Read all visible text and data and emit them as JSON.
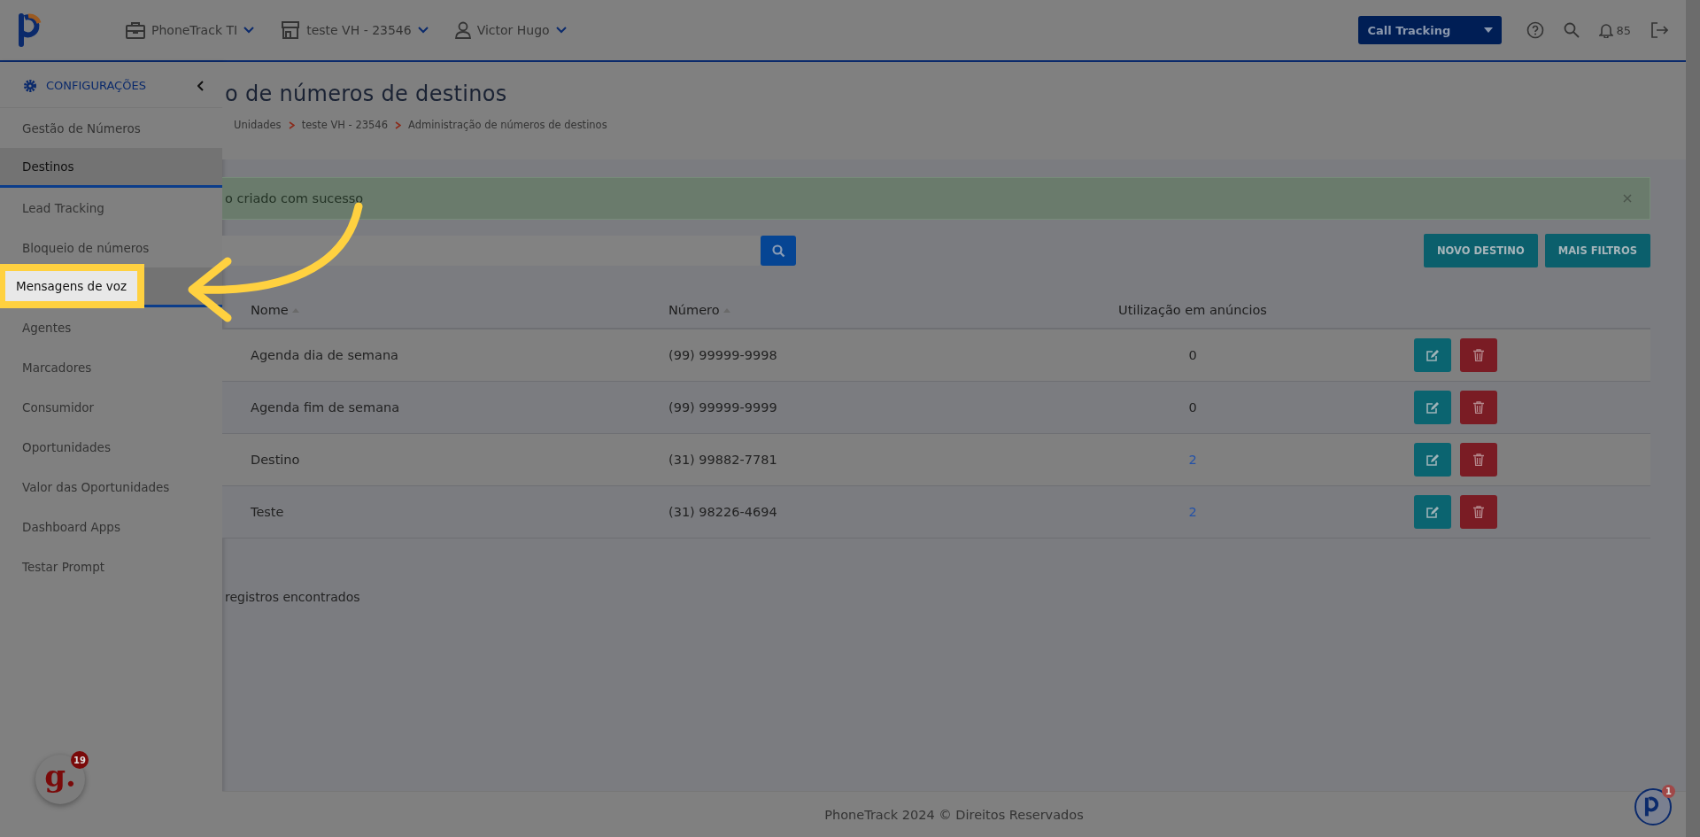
{
  "topbar": {
    "menus": [
      {
        "kind": "company",
        "label": "PhoneTrack TI"
      },
      {
        "kind": "store",
        "label": "teste VH - 23546"
      },
      {
        "kind": "user",
        "label": "Victor Hugo"
      }
    ],
    "product_select": "Call Tracking",
    "notifications": "85"
  },
  "sidebar": {
    "title": "CONFIGURAÇÕES",
    "items": [
      {
        "label": "Gestão de Números",
        "selected": false,
        "highlighted": false
      },
      {
        "label": "Destinos",
        "selected": true,
        "highlighted": false
      },
      {
        "label": "Lead Tracking",
        "selected": false,
        "highlighted": false
      },
      {
        "label": "Bloqueio de números",
        "selected": false,
        "highlighted": false
      },
      {
        "label": "Mensagens de voz",
        "selected": true,
        "highlighted": true
      },
      {
        "label": "Agentes",
        "selected": false,
        "highlighted": false
      },
      {
        "label": "Marcadores",
        "selected": false,
        "highlighted": false
      },
      {
        "label": "Consumidor",
        "selected": false,
        "highlighted": false
      },
      {
        "label": "Oportunidades",
        "selected": false,
        "highlighted": false
      },
      {
        "label": "Valor das Oportunidades",
        "selected": false,
        "highlighted": false
      },
      {
        "label": "Dashboard Apps",
        "selected": false,
        "highlighted": false
      },
      {
        "label": "Testar Prompt",
        "selected": false,
        "highlighted": false
      }
    ]
  },
  "page": {
    "title": "o de números de destinos",
    "breadcrumb": [
      "Unidades",
      "teste VH - 23546",
      "Administração de números de destinos"
    ],
    "alert": "o criado com sucesso",
    "buttons": [
      "NOVO DESTINO",
      "MAIS FILTROS"
    ]
  },
  "table": {
    "columns": [
      {
        "label": "Nome",
        "sortable": true
      },
      {
        "label": "Número",
        "sortable": true
      },
      {
        "label": "Utilização em anúncios",
        "sortable": false
      }
    ],
    "rows": [
      {
        "name": "Agenda dia de semana",
        "number": "(99) 99999-9998",
        "usage": "0",
        "usage_link": false
      },
      {
        "name": "Agenda fim de semana",
        "number": "(99) 99999-9999",
        "usage": "0",
        "usage_link": false
      },
      {
        "name": "Destino",
        "number": "(31) 99882-7781",
        "usage": "2",
        "usage_link": true
      },
      {
        "name": "Teste",
        "number": "(31) 98226-4694",
        "usage": "2",
        "usage_link": true
      }
    ]
  },
  "records_text": "registros encontrados",
  "footer": "PhoneTrack 2024 © Direitos Reservados",
  "chat_widget": {
    "label": "g.",
    "count": "19"
  },
  "help_widget": {
    "count": "1"
  }
}
